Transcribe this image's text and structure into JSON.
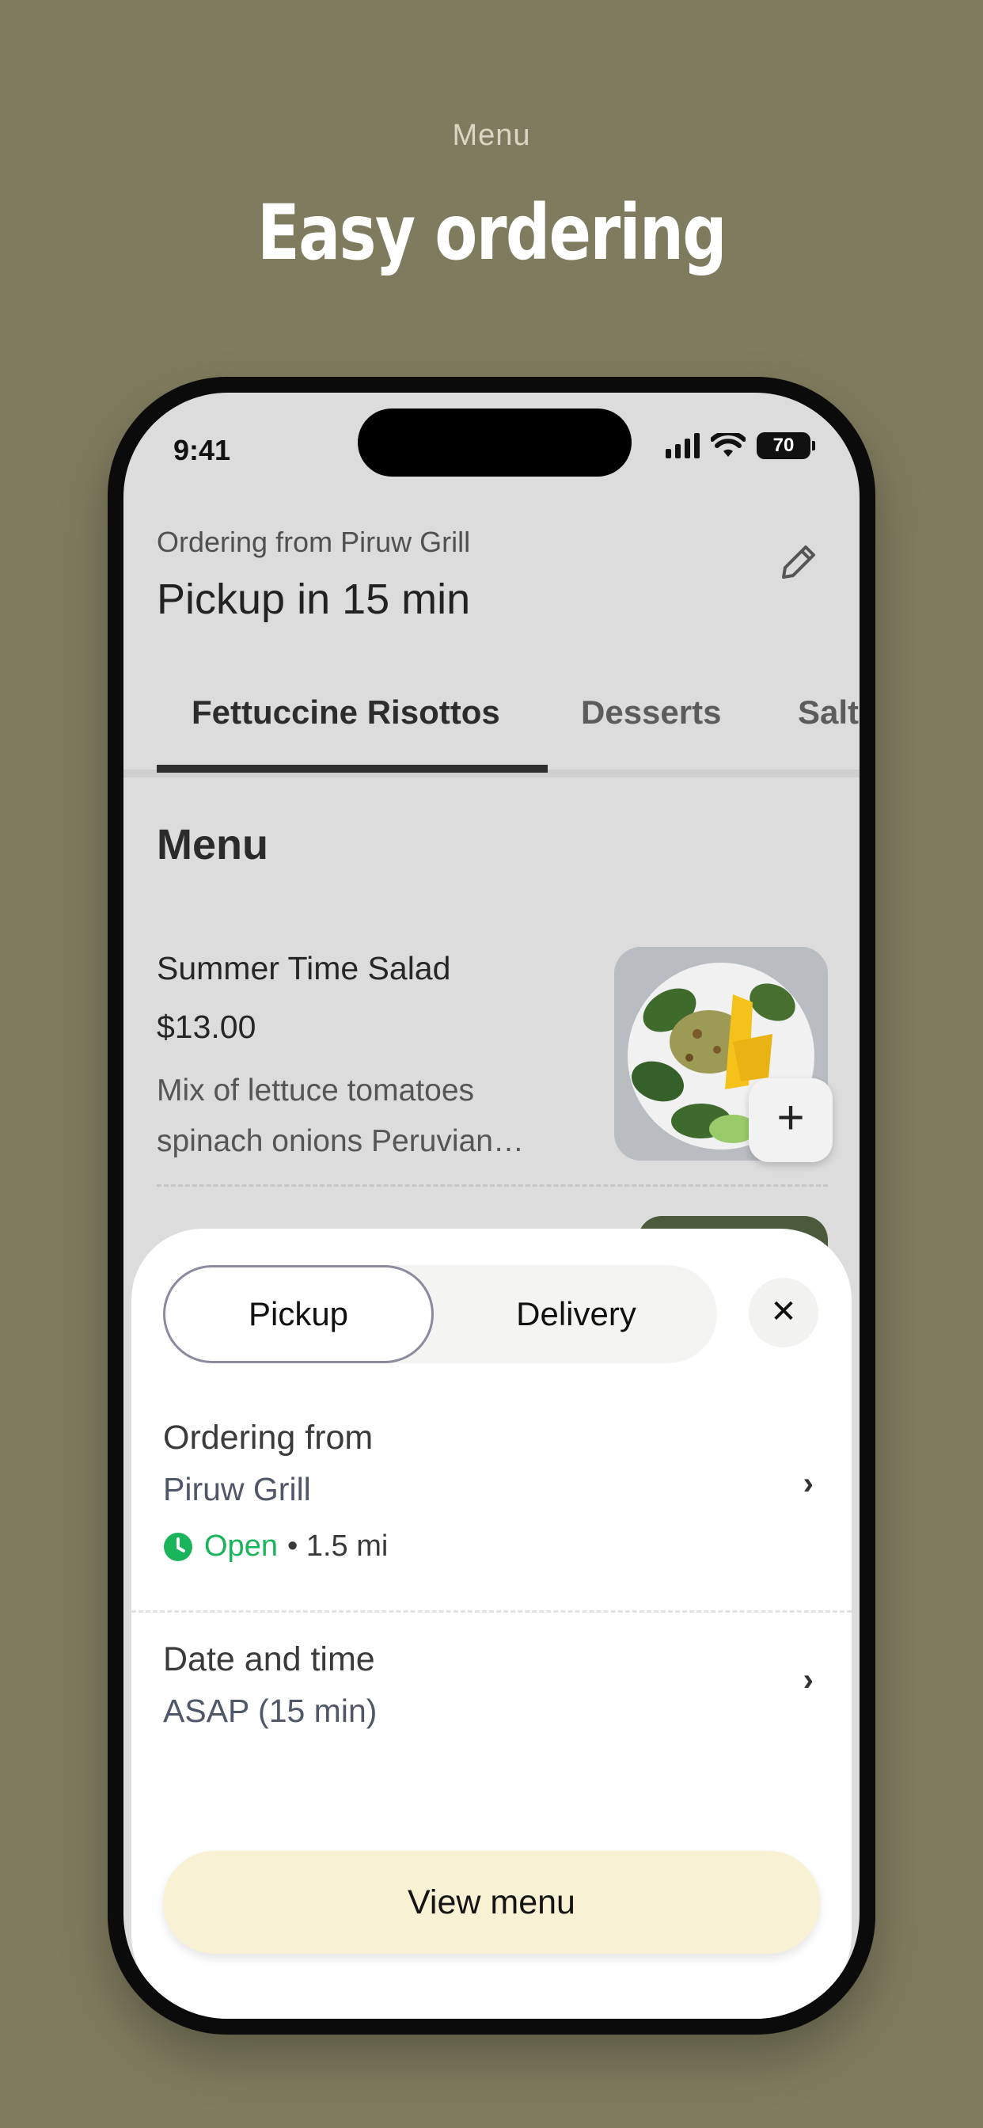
{
  "promo": {
    "eyebrow": "Menu",
    "title": "Easy ordering"
  },
  "status_bar": {
    "time": "9:41",
    "battery": "70",
    "icons": [
      "signal-icon",
      "wifi-icon",
      "battery-icon"
    ]
  },
  "header": {
    "subtitle": "Ordering from Piruw Grill",
    "title": "Pickup in 15 min",
    "edit_icon": "pencil-icon"
  },
  "tabs": [
    {
      "label": "Fettuccine Risottos",
      "active": true
    },
    {
      "label": "Desserts",
      "active": false
    },
    {
      "label": "Salt",
      "active": false
    }
  ],
  "menu": {
    "section_title": "Menu",
    "items": [
      {
        "name": "Summer Time Salad",
        "price": "$13.00",
        "description": "Mix of lettuce tomatoes spinach onions Peruvian…",
        "add_label": "+"
      }
    ]
  },
  "sheet": {
    "toggle": {
      "selected": "Pickup",
      "other": "Delivery"
    },
    "close_label": "✕",
    "ordering_from": {
      "title": "Ordering from",
      "value": "Piruw Grill",
      "status": "Open",
      "distance": "• 1.5 mi"
    },
    "date_time": {
      "title": "Date and time",
      "value": "ASAP (15 min)"
    },
    "chevron": "›",
    "cta_label": "View menu"
  },
  "colors": {
    "background": "#7e7b5e",
    "open_status": "#1ab45a",
    "cta_background": "#f8f1d4",
    "active_tab_underline": "#2e2e2e"
  }
}
